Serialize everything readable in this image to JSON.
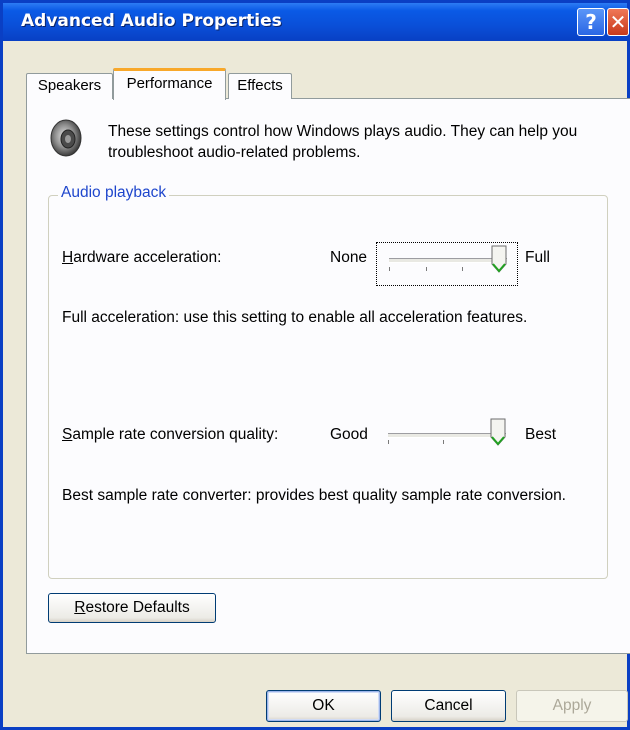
{
  "window": {
    "title": "Advanced Audio Properties",
    "help_label": "?",
    "close_label": "✕"
  },
  "tabs": [
    {
      "label": "Speakers",
      "active": false
    },
    {
      "label": "Performance",
      "active": true
    },
    {
      "label": "Effects",
      "active": false
    }
  ],
  "intro": {
    "icon": "speaker-icon",
    "text": "These settings control how Windows plays audio. They can help you troubleshoot audio-related problems."
  },
  "group": {
    "title": "Audio playback"
  },
  "hardware_acceleration": {
    "label_first": "H",
    "label_rest": "ardware acceleration:",
    "min_label": "None",
    "max_label": "Full",
    "value": 3,
    "max": 3,
    "description": "Full acceleration: use this setting to enable all acceleration features."
  },
  "sample_rate": {
    "label_first": "S",
    "label_rest": "ample rate conversion quality:",
    "min_label": "Good",
    "max_label": "Best",
    "value": 2,
    "max": 2,
    "description": "Best sample rate converter:  provides best quality sample rate conversion."
  },
  "buttons": {
    "restore_first": "R",
    "restore_rest": "estore Defaults",
    "ok": "OK",
    "cancel": "Cancel",
    "apply": "Apply"
  },
  "colors": {
    "titlebar": "#0a4fd8",
    "face": "#ece9d8",
    "group_title": "#1e46cc",
    "thumb_accent": "#21a121"
  }
}
